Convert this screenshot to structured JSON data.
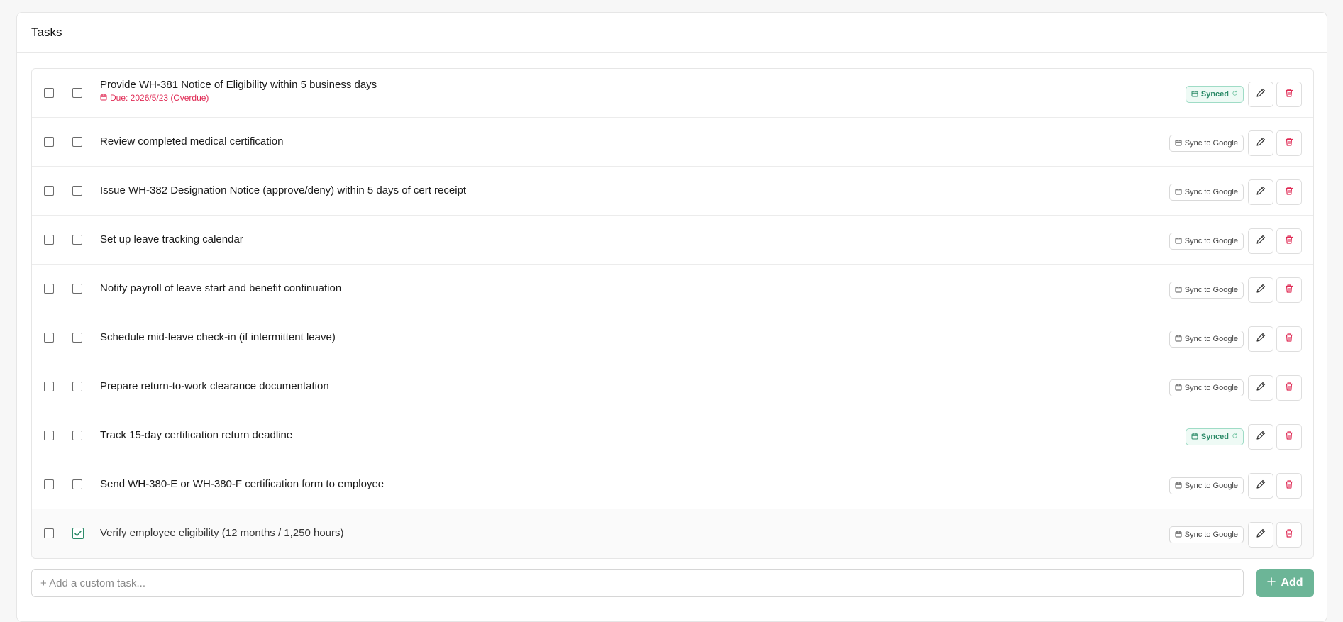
{
  "panel": {
    "title": "Tasks"
  },
  "tasks": [
    {
      "title": "Provide WH-381 Notice of Eligibility within 5 business days",
      "due": "Due: 2026/5/23 (Overdue)",
      "sync": "Synced",
      "synced": true,
      "completed": false
    },
    {
      "title": "Review completed medical certification",
      "due": "",
      "sync": "Sync to Google",
      "synced": false,
      "completed": false
    },
    {
      "title": "Issue WH-382 Designation Notice (approve/deny) within 5 days of cert receipt",
      "due": "",
      "sync": "Sync to Google",
      "synced": false,
      "completed": false
    },
    {
      "title": "Set up leave tracking calendar",
      "due": "",
      "sync": "Sync to Google",
      "synced": false,
      "completed": false
    },
    {
      "title": "Notify payroll of leave start and benefit continuation",
      "due": "",
      "sync": "Sync to Google",
      "synced": false,
      "completed": false
    },
    {
      "title": "Schedule mid-leave check-in (if intermittent leave)",
      "due": "",
      "sync": "Sync to Google",
      "synced": false,
      "completed": false
    },
    {
      "title": "Prepare return-to-work clearance documentation",
      "due": "",
      "sync": "Sync to Google",
      "synced": false,
      "completed": false
    },
    {
      "title": "Track 15-day certification return deadline",
      "due": "",
      "sync": "Synced",
      "synced": true,
      "completed": false
    },
    {
      "title": "Send WH-380-E or WH-380-F certification form to employee",
      "due": "",
      "sync": "Sync to Google",
      "synced": false,
      "completed": false
    },
    {
      "title": "Verify employee eligibility (12 months / 1,250 hours)",
      "due": "",
      "sync": "Sync to Google",
      "synced": false,
      "completed": true
    }
  ],
  "add_task": {
    "placeholder": "+ Add a custom task...",
    "value": "",
    "button_label": "Add"
  },
  "colors": {
    "accent": "#6cb597",
    "overdue": "#e02b55",
    "synced": "#2a8a67",
    "delete": "#e02b55"
  }
}
